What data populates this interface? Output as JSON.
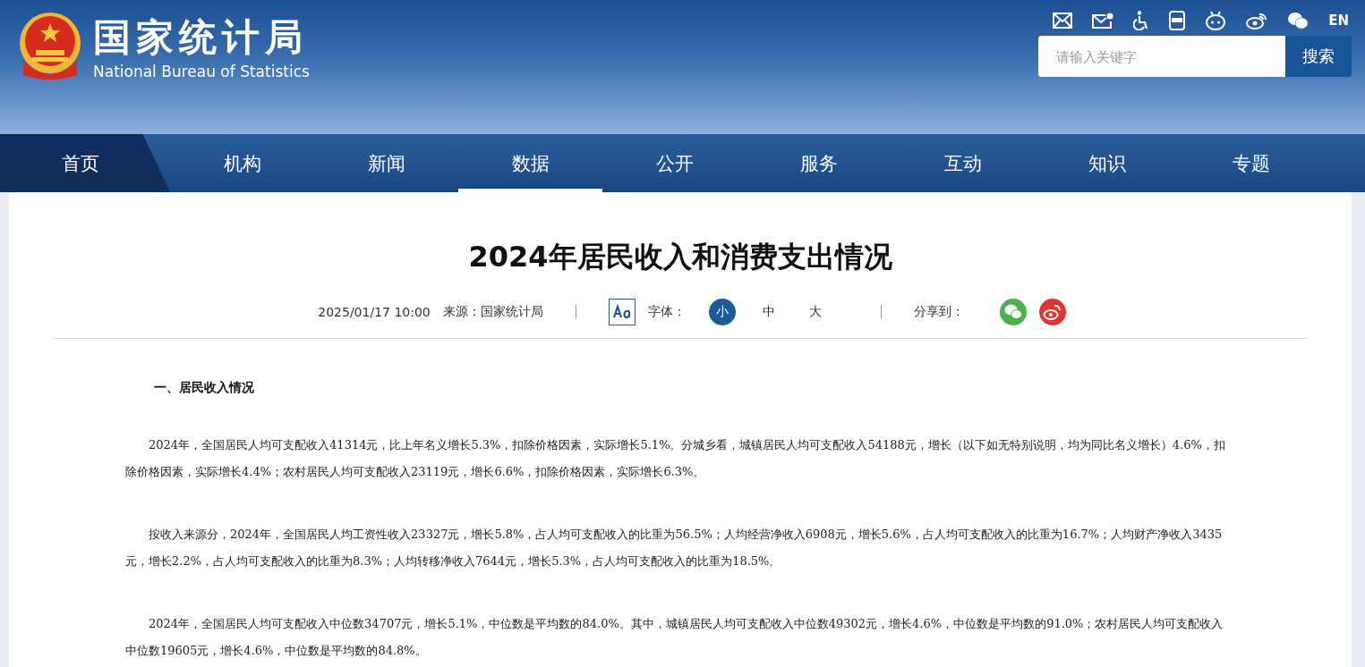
{
  "header": {
    "site_name": "国家统计局",
    "site_name_en": "National Bureau of Statistics",
    "language_link": "EN",
    "search": {
      "placeholder": "请输入关键字",
      "button": "搜索"
    }
  },
  "nav": [
    {
      "label": "首页",
      "selected": false,
      "kind": "home"
    },
    {
      "label": "机构",
      "selected": false,
      "kind": "item"
    },
    {
      "label": "新闻",
      "selected": false,
      "kind": "item"
    },
    {
      "label": "数据",
      "selected": true,
      "kind": "item"
    },
    {
      "label": "公开",
      "selected": false,
      "kind": "item"
    },
    {
      "label": "服务",
      "selected": false,
      "kind": "item"
    },
    {
      "label": "互动",
      "selected": false,
      "kind": "item"
    },
    {
      "label": "知识",
      "selected": false,
      "kind": "item"
    },
    {
      "label": "专题",
      "selected": false,
      "kind": "item"
    }
  ],
  "article": {
    "title": "2024年居民收入和消费支出情况",
    "meta": {
      "date": "2025/01/17 10:00",
      "source": "来源：国家统计局",
      "font_label": "字体：",
      "font_sizes": [
        {
          "label": "小",
          "selected": true
        },
        {
          "label": "中",
          "selected": false
        },
        {
          "label": "大",
          "selected": false
        }
      ],
      "share_label": "分享到："
    },
    "sections": [
      {
        "heading": "一、居民收入情况",
        "paragraphs": [
          "2024年，全国居民人均可支配收入41314元，比上年名义增长5.3%，扣除价格因素，实际增长5.1%。分城乡看，城镇居民人均可支配收入54188元，增长（以下如无特别说明，均为同比名义增长）4.6%，扣除价格因素，实际增长4.4%；农村居民人均可支配收入23119元，增长6.6%，扣除价格因素，实际增长6.3%。",
          "按收入来源分，2024年，全国居民人均工资性收入23327元，增长5.8%，占人均可支配收入的比重为56.5%；人均经营净收入6908元，增长5.6%，占人均可支配收入的比重为16.7%；人均财产净收入3435元，增长2.2%，占人均可支配收入的比重为8.3%；人均转移净收入7644元，增长5.3%，占人均可支配收入的比重为18.5%。",
          "2024年，全国居民人均可支配收入中位数34707元，增长5.1%，中位数是平均数的84.0%。其中，城镇居民人均可支配收入中位数49302元，增长4.6%，中位数是平均数的91.0%；农村居民人均可支配收入中位数19605元，增长4.6%，中位数是平均数的84.8%。"
        ]
      }
    ]
  }
}
